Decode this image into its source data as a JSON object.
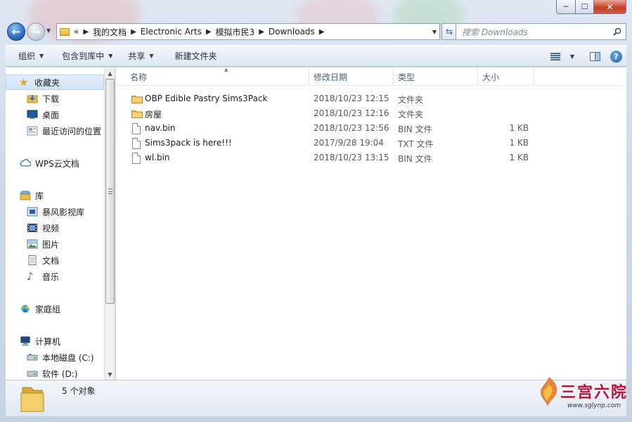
{
  "window": {
    "caption_min": "─",
    "caption_max": "☐",
    "caption_close": "✕"
  },
  "address": {
    "overflow": "«",
    "crumbs": [
      "我的文档",
      "Electronic Arts",
      "模拟市民3",
      "Downloads"
    ]
  },
  "search": {
    "placeholder": "搜索 Downloads"
  },
  "toolbar": {
    "organize": "组织",
    "include_in_library": "包含到库中",
    "share": "共享",
    "new_folder": "新建文件夹",
    "help": "?"
  },
  "nav": {
    "favorites": "收藏夹",
    "favorites_items": [
      "下载",
      "桌面",
      "最近访问的位置"
    ],
    "wps_cloud": "WPS云文档",
    "libraries": "库",
    "library_items": [
      "暴风影视库",
      "视频",
      "图片",
      "文档",
      "音乐"
    ],
    "homegroup": "家庭组",
    "computer": "计算机",
    "computer_items": [
      "本地磁盘 (C:)",
      "软件 (D:)"
    ]
  },
  "columns": {
    "name": "名称",
    "date": "修改日期",
    "type": "类型",
    "size": "大小"
  },
  "files": [
    {
      "name": "OBP Edible Pastry Sims3Pack",
      "date": "2018/10/23 12:15",
      "type": "文件夹",
      "size": "",
      "kind": "folder"
    },
    {
      "name": "房屋",
      "date": "2018/10/23 12:16",
      "type": "文件夹",
      "size": "",
      "kind": "folder"
    },
    {
      "name": "nav.bin",
      "date": "2018/10/23 12:56",
      "type": "BIN 文件",
      "size": "1 KB",
      "kind": "file"
    },
    {
      "name": "Sims3pack is here!!!",
      "date": "2017/9/28 19:04",
      "type": "TXT 文件",
      "size": "1 KB",
      "kind": "file"
    },
    {
      "name": "wl.bin",
      "date": "2018/10/23 13:15",
      "type": "BIN 文件",
      "size": "1 KB",
      "kind": "file"
    }
  ],
  "status": {
    "count": "5 个对象"
  },
  "watermark": {
    "text": "三宫六院",
    "url": "www.sglynp.com"
  },
  "colors": {
    "folder": "#e8bd4a",
    "accent": "#2f6fc0",
    "selection": "#d3e2f6"
  }
}
